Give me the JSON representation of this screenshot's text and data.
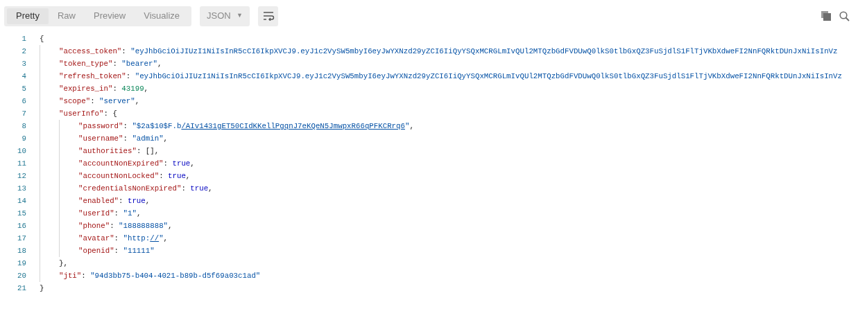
{
  "toolbar": {
    "tabs": [
      {
        "label": "Pretty",
        "selected": true
      },
      {
        "label": "Raw",
        "selected": false
      },
      {
        "label": "Preview",
        "selected": false
      },
      {
        "label": "Visualize",
        "selected": false
      }
    ],
    "format": {
      "value": "JSON",
      "caret": "▼"
    }
  },
  "editor": {
    "lines": [
      {
        "number": "1",
        "tokens": [
          {
            "kind": "punct",
            "text": "{"
          }
        ],
        "children": [
          {
            "number": "2",
            "tokens": [
              {
                "kind": "key",
                "text": "\"access_token\""
              },
              {
                "kind": "punct",
                "text": ": "
              },
              {
                "kind": "string",
                "text": "\"eyJhbGciOiJIUzI1NiIsInR5cCI6IkpXVCJ9.eyJ1c2VySW5mbyI6eyJwYXNzd29yZCI6IiQyYSQxMCRGLmIvQUl2MTQzbGdFVDUwQ0lkS0tlbGxQZ3FuSjdlS1FlTjVKbXdweFI2NnFQRktDUnJxNiIsInVz"
              }
            ]
          },
          {
            "number": "3",
            "tokens": [
              {
                "kind": "key",
                "text": "\"token_type\""
              },
              {
                "kind": "punct",
                "text": ": "
              },
              {
                "kind": "string",
                "text": "\"bearer\""
              },
              {
                "kind": "punct",
                "text": ","
              }
            ]
          },
          {
            "number": "4",
            "tokens": [
              {
                "kind": "key",
                "text": "\"refresh_token\""
              },
              {
                "kind": "punct",
                "text": ": "
              },
              {
                "kind": "string",
                "text": "\"eyJhbGciOiJIUzI1NiIsInR5cCI6IkpXVCJ9.eyJ1c2VySW5mbyI6eyJwYXNzd29yZCI6IiQyYSQxMCRGLmIvQUl2MTQzbGdFVDUwQ0lkS0tlbGxQZ3FuSjdlS1FlTjVKbXdweFI2NnFQRktDUnJxNiIsInVz"
              }
            ]
          },
          {
            "number": "5",
            "tokens": [
              {
                "kind": "key",
                "text": "\"expires_in\""
              },
              {
                "kind": "punct",
                "text": ": "
              },
              {
                "kind": "number",
                "text": "43199"
              },
              {
                "kind": "punct",
                "text": ","
              }
            ]
          },
          {
            "number": "6",
            "tokens": [
              {
                "kind": "key",
                "text": "\"scope\""
              },
              {
                "kind": "punct",
                "text": ": "
              },
              {
                "kind": "string",
                "text": "\"server\""
              },
              {
                "kind": "punct",
                "text": ","
              }
            ]
          },
          {
            "number": "7",
            "tokens": [
              {
                "kind": "key",
                "text": "\"userInfo\""
              },
              {
                "kind": "punct",
                "text": ": {"
              }
            ],
            "children": [
              {
                "number": "8",
                "tokens": [
                  {
                    "kind": "key",
                    "text": "\"password\""
                  },
                  {
                    "kind": "punct",
                    "text": ": "
                  },
                  {
                    "kind": "string",
                    "text": "\"$2a$10$F.b"
                  },
                  {
                    "kind": "link",
                    "text": "/AIv1431gET50CIdKKellPgqnJ7eKQeN5JmwpxR66qPFKCRrq6"
                  },
                  {
                    "kind": "string",
                    "text": "\""
                  },
                  {
                    "kind": "punct",
                    "text": ","
                  }
                ]
              },
              {
                "number": "9",
                "tokens": [
                  {
                    "kind": "key",
                    "text": "\"username\""
                  },
                  {
                    "kind": "punct",
                    "text": ": "
                  },
                  {
                    "kind": "string",
                    "text": "\"admin\""
                  },
                  {
                    "kind": "punct",
                    "text": ","
                  }
                ]
              },
              {
                "number": "10",
                "tokens": [
                  {
                    "kind": "key",
                    "text": "\"authorities\""
                  },
                  {
                    "kind": "punct",
                    "text": ": [],"
                  }
                ]
              },
              {
                "number": "11",
                "tokens": [
                  {
                    "kind": "key",
                    "text": "\"accountNonExpired\""
                  },
                  {
                    "kind": "punct",
                    "text": ": "
                  },
                  {
                    "kind": "bool",
                    "text": "true"
                  },
                  {
                    "kind": "punct",
                    "text": ","
                  }
                ]
              },
              {
                "number": "12",
                "tokens": [
                  {
                    "kind": "key",
                    "text": "\"accountNonLocked\""
                  },
                  {
                    "kind": "punct",
                    "text": ": "
                  },
                  {
                    "kind": "bool",
                    "text": "true"
                  },
                  {
                    "kind": "punct",
                    "text": ","
                  }
                ]
              },
              {
                "number": "13",
                "tokens": [
                  {
                    "kind": "key",
                    "text": "\"credentialsNonExpired\""
                  },
                  {
                    "kind": "punct",
                    "text": ": "
                  },
                  {
                    "kind": "bool",
                    "text": "true"
                  },
                  {
                    "kind": "punct",
                    "text": ","
                  }
                ]
              },
              {
                "number": "14",
                "tokens": [
                  {
                    "kind": "key",
                    "text": "\"enabled\""
                  },
                  {
                    "kind": "punct",
                    "text": ": "
                  },
                  {
                    "kind": "bool",
                    "text": "true"
                  },
                  {
                    "kind": "punct",
                    "text": ","
                  }
                ]
              },
              {
                "number": "15",
                "tokens": [
                  {
                    "kind": "key",
                    "text": "\"userId\""
                  },
                  {
                    "kind": "punct",
                    "text": ": "
                  },
                  {
                    "kind": "string",
                    "text": "\"1\""
                  },
                  {
                    "kind": "punct",
                    "text": ","
                  }
                ]
              },
              {
                "number": "16",
                "tokens": [
                  {
                    "kind": "key",
                    "text": "\"phone\""
                  },
                  {
                    "kind": "punct",
                    "text": ": "
                  },
                  {
                    "kind": "string",
                    "text": "\"188888888\""
                  },
                  {
                    "kind": "punct",
                    "text": ","
                  }
                ]
              },
              {
                "number": "17",
                "tokens": [
                  {
                    "kind": "key",
                    "text": "\"avatar\""
                  },
                  {
                    "kind": "punct",
                    "text": ": "
                  },
                  {
                    "kind": "string",
                    "text": "\"http:"
                  },
                  {
                    "kind": "link",
                    "text": "//"
                  },
                  {
                    "kind": "string",
                    "text": "\""
                  },
                  {
                    "kind": "punct",
                    "text": ","
                  }
                ]
              },
              {
                "number": "18",
                "tokens": [
                  {
                    "kind": "key",
                    "text": "\"openid\""
                  },
                  {
                    "kind": "punct",
                    "text": ": "
                  },
                  {
                    "kind": "string",
                    "text": "\"11111\""
                  }
                ]
              }
            ]
          },
          {
            "number": "19",
            "tokens": [
              {
                "kind": "punct",
                "text": "},"
              }
            ]
          },
          {
            "number": "20",
            "tokens": [
              {
                "kind": "key",
                "text": "\"jti\""
              },
              {
                "kind": "punct",
                "text": ": "
              },
              {
                "kind": "string",
                "text": "\"94d3bb75-b404-4021-b89b-d5f69a03c1ad\""
              }
            ]
          }
        ]
      },
      {
        "number": "21",
        "tokens": [
          {
            "kind": "punct",
            "text": "}"
          }
        ]
      }
    ]
  }
}
